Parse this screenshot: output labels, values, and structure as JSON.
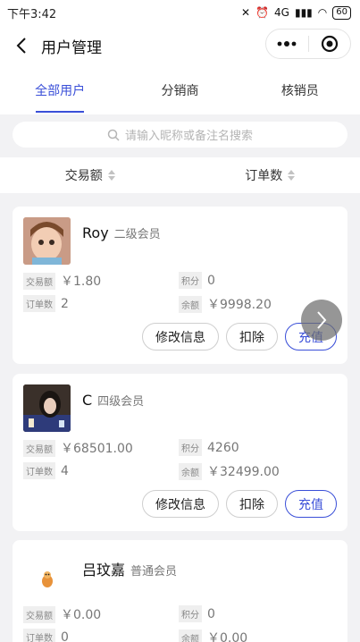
{
  "status": {
    "time": "下午3:42",
    "signal": "4G",
    "battery": "60"
  },
  "nav": {
    "title": "用户管理"
  },
  "tabs": [
    {
      "label": "全部用户"
    },
    {
      "label": "分销商"
    },
    {
      "label": "核销员"
    }
  ],
  "search": {
    "placeholder": "请输入昵称或备注名搜索"
  },
  "sort": [
    {
      "label": "交易额"
    },
    {
      "label": "订单数"
    }
  ],
  "labels": {
    "trade": "交易额",
    "points": "积分",
    "orders": "订单数",
    "balance": "余额"
  },
  "buttons": {
    "edit": "修改信息",
    "deduct": "扣除",
    "recharge": "充值"
  },
  "users": [
    {
      "name": "Roy",
      "level": "二级会员",
      "trade": "￥1.80",
      "points": "0",
      "orders": "2",
      "balance": "￥9998.20"
    },
    {
      "name": "C",
      "level": "四级会员",
      "trade": "￥68501.00",
      "points": "4260",
      "orders": "4",
      "balance": "￥32499.00"
    },
    {
      "name": "吕玟嘉",
      "level": "普通会员",
      "trade": "￥0.00",
      "points": "0",
      "orders": "0",
      "balance": "￥0.00"
    }
  ],
  "colors": {
    "accent": "#3a4fd8",
    "background": "#f2f2f4"
  }
}
